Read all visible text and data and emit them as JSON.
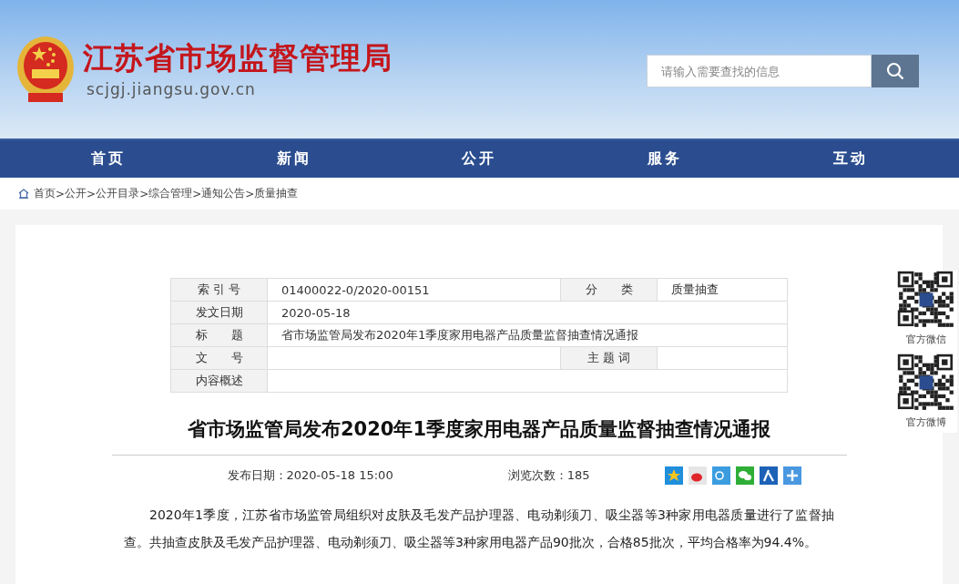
{
  "site": {
    "name": "江苏省市场监督管理局",
    "domain": "scjgj.jiangsu.gov.cn"
  },
  "search": {
    "placeholder": "请输入需要查找的信息"
  },
  "nav": [
    {
      "label": "首页"
    },
    {
      "label": "新闻"
    },
    {
      "label": "公开"
    },
    {
      "label": "服务"
    },
    {
      "label": "互动"
    }
  ],
  "breadcrumb": [
    "首页",
    ">",
    "公开",
    ">",
    "公开目录",
    ">",
    "综合管理",
    ">",
    "通知公告",
    ">",
    "质量抽查"
  ],
  "info_table": [
    {
      "label": "索 引 号",
      "value": "01400022-0/2020-00151",
      "label_2": "分　　类",
      "value_2": "质量抽查"
    },
    {
      "label": "发文日期",
      "value": "2020-05-18"
    },
    {
      "label": "标　　题",
      "value": "省市场监管局发布2020年1季度家用电器产品质量监督抽查情况通报"
    },
    {
      "label": "文　　号",
      "label_2": "主 题 词"
    },
    {
      "label": "内容概述"
    }
  ],
  "article": {
    "title": "省市场监管局发布2020年1季度家用电器产品质量监督抽查情况通报",
    "publish_date": "发布日期：2020-05-18 15:00",
    "views": "浏览次数：185",
    "share": [
      {
        "kind": "qzone"
      },
      {
        "kind": "weibo"
      },
      {
        "kind": "tweibo"
      },
      {
        "kind": "wechat"
      },
      {
        "kind": "renren"
      },
      {
        "kind": "more"
      }
    ],
    "body": "2020年1季度，江苏省市场监管局组织对皮肤及毛发产品护理器、电动剃须刀、吸尘器等3种家用电器质量进行了监督抽查。共抽查皮肤及毛发产品护理器、电动剃须刀、吸尘器等3种家用电器产品90批次，合格85批次，平均合格率为94.4%。"
  },
  "qr_codes": [
    {
      "label": "官方微信"
    },
    {
      "label": "官方微博"
    }
  ]
}
